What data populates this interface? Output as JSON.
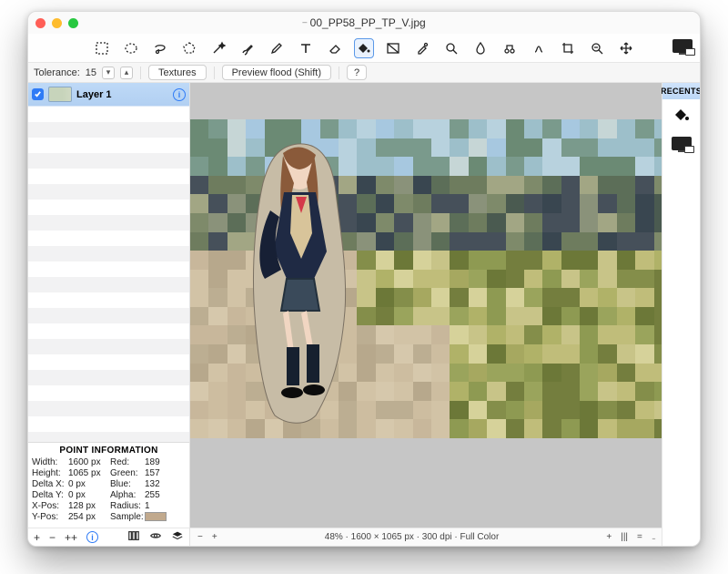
{
  "title": "00_PP58_PP_TP_V.jpg",
  "edited_marker": "–",
  "options": {
    "tolerance_label": "Tolerance:",
    "tolerance_value": "15",
    "textures_label": "Textures",
    "preview_label": "Preview flood (Shift)",
    "help_label": "?"
  },
  "layers": {
    "layer1_name": "Layer 1"
  },
  "point_info": {
    "heading": "POINT INFORMATION",
    "width_k": "Width:",
    "width_v": "1600 px",
    "height_k": "Height:",
    "height_v": "1065 px",
    "dx_k": "Delta X:",
    "dx_v": "0 px",
    "dy_k": "Delta Y:",
    "dy_v": "0 px",
    "xp_k": "X-Pos:",
    "xp_v": "128 px",
    "yp_k": "Y-Pos:",
    "yp_v": "254 px",
    "red_k": "Red:",
    "red_v": "189",
    "green_k": "Green:",
    "green_v": "157",
    "blue_k": "Blue:",
    "blue_v": "132",
    "alpha_k": "Alpha:",
    "alpha_v": "255",
    "radius_k": "Radius:",
    "radius_v": "1",
    "sample_k": "Sample:"
  },
  "status": {
    "zoom": "48%",
    "dims": "1600 × 1065 px",
    "dpi": "300 dpi",
    "mode": "Full Color"
  },
  "right": {
    "recents": "RECENTS"
  },
  "footer_symbols": {
    "plus": "+",
    "minus": "−",
    "pp": "++"
  },
  "colors": {
    "sample_hex": "#c1a98d"
  }
}
